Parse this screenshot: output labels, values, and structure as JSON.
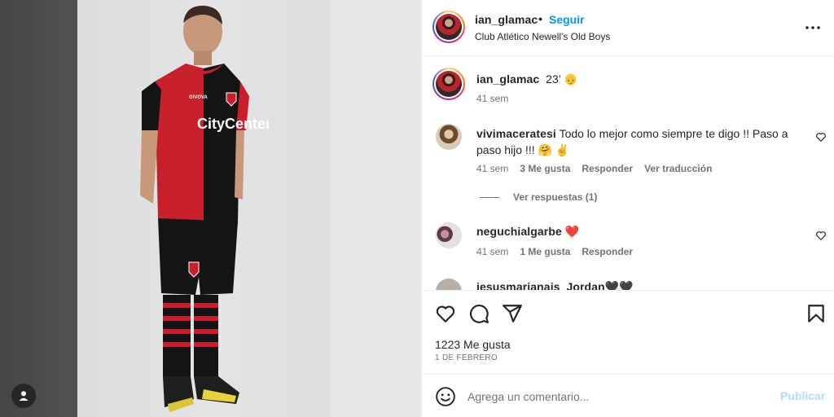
{
  "post": {
    "author": "ian_glamac",
    "separator": "•",
    "follow_label": "Seguir",
    "location": "Club Atlético Newell's Old Boys",
    "more_icon": "more-horizontal-icon"
  },
  "photo": {
    "jersey_text": "CityCenter",
    "brand_text": "GIVOVA"
  },
  "caption": {
    "username": "ian_glamac",
    "text": "23’ 👴",
    "time": "41 sem"
  },
  "comments": [
    {
      "username": "vivimaceratesi",
      "text": "Todo lo mejor como siempre te digo !! Paso a paso hijo !!! 🤗 ✌️",
      "time": "41 sem",
      "likes": "3 Me gusta",
      "reply_label": "Responder",
      "translate_label": "Ver traducción",
      "view_replies": "Ver respuestas (1)"
    },
    {
      "username": "neguchialgarbe",
      "text": "❤️",
      "time": "41 sem",
      "likes": "1 Me gusta",
      "reply_label": "Responder"
    },
    {
      "username": "jesusmarianais_Jordan🖤🖤"
    }
  ],
  "actions": {
    "likes_count": "1223 Me gusta",
    "date": "1 DE FEBRERO"
  },
  "add_comment": {
    "placeholder": "Agrega un comentario...",
    "publish_label": "Publicar"
  },
  "colors": {
    "accent": "#0095f6",
    "publish_disabled": "#b3dbff",
    "heart_red": "#ed4956",
    "muted_text": "#737373",
    "jersey_red": "#c8202b",
    "jersey_black": "#141414"
  }
}
